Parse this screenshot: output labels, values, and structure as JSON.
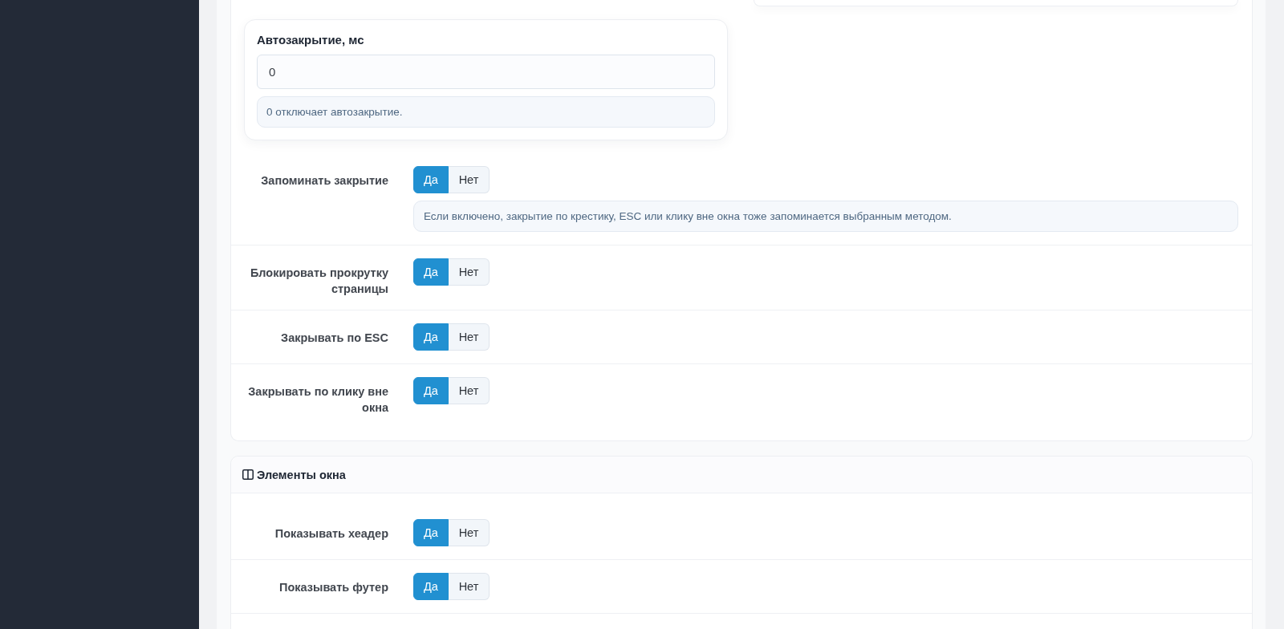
{
  "autoclose_field": {
    "label": "Автозакрытие, мс",
    "value": "0",
    "hint": "0 отключает автозакрытие."
  },
  "behavior_settings": [
    {
      "label": "Запоминать закрытие",
      "options": [
        {
          "label": "Да",
          "selected": true
        },
        {
          "label": "Нет",
          "selected": false
        }
      ],
      "hint": "Если включено, закрытие по крестику, ESC или клику вне окна тоже запоминается выбранным методом."
    },
    {
      "label": "Блокировать прокрутку страницы",
      "options": [
        {
          "label": "Да",
          "selected": true
        },
        {
          "label": "Нет",
          "selected": false
        }
      ]
    },
    {
      "label": "Закрывать по ESC",
      "options": [
        {
          "label": "Да",
          "selected": true
        },
        {
          "label": "Нет",
          "selected": false
        }
      ]
    },
    {
      "label": "Закрывать по клику вне окна",
      "options": [
        {
          "label": "Да",
          "selected": true
        },
        {
          "label": "Нет",
          "selected": false
        }
      ]
    }
  ],
  "window_elements": {
    "title": "Элементы окна",
    "settings": [
      {
        "label": "Показывать хеадер",
        "options": [
          {
            "label": "Да",
            "selected": true
          },
          {
            "label": "Нет",
            "selected": false
          }
        ]
      },
      {
        "label": "Показывать футер",
        "options": [
          {
            "label": "Да",
            "selected": true
          },
          {
            "label": "Нет",
            "selected": false
          }
        ]
      }
    ]
  }
}
